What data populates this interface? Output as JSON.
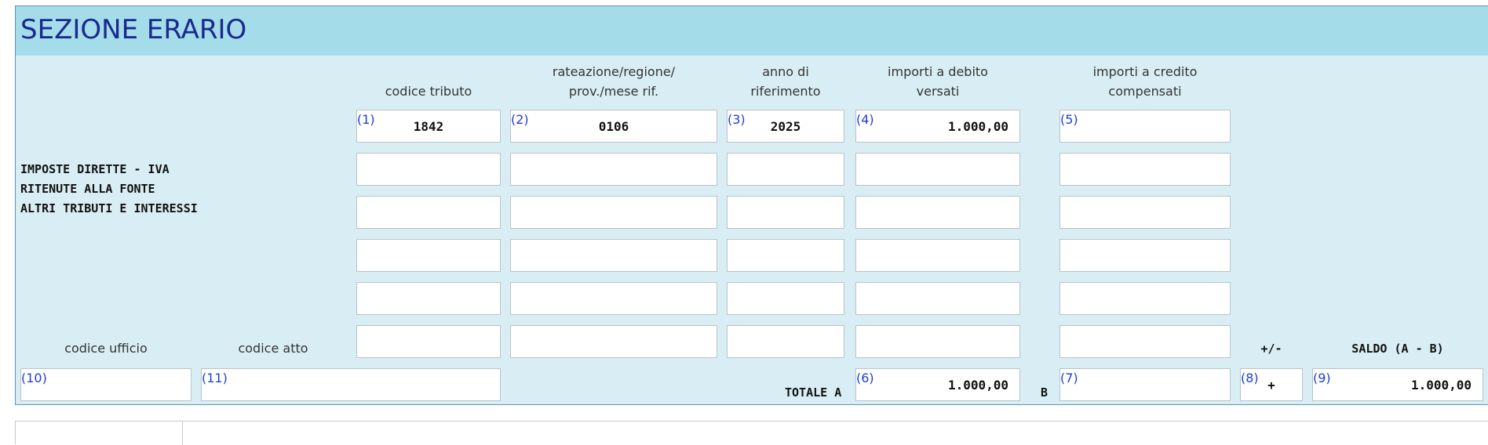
{
  "section": {
    "title": "SEZIONE ERARIO"
  },
  "columns": {
    "codice_tributo": "codice tributo",
    "rateazione": "rateazione/regione/\nprov./mese rif.",
    "anno": "anno di\nriferimento",
    "debito": "importi a debito\nversati",
    "credito": "importi a credito\ncompensati"
  },
  "indices": {
    "i1": "(1)",
    "i2": "(2)",
    "i3": "(3)",
    "i4": "(4)",
    "i5": "(5)",
    "i6": "(6)",
    "i7": "(7)",
    "i8": "(8)",
    "i9": "(9)",
    "i10": "(10)",
    "i11": "(11)"
  },
  "row1": {
    "codice_tributo": "1842",
    "rateazione": "0106",
    "anno": "2025",
    "debito": "1.000,00",
    "credito": ""
  },
  "tax_labels": {
    "line1": "IMPOSTE DIRETTE - IVA",
    "line2": "RITENUTE ALLA FONTE",
    "line3": "ALTRI TRIBUTI E INTERESSI"
  },
  "footer": {
    "codice_ufficio_label": "codice ufficio",
    "codice_atto_label": "codice atto",
    "sign_label": "+/-",
    "saldo_label": "SALDO (A - B)",
    "totale_a_label": "TOTALE A",
    "b_label": "B",
    "totale_a": "1.000,00",
    "totale_b": "",
    "sign": "+",
    "saldo": "1.000,00",
    "codice_ufficio": "",
    "codice_atto": ""
  }
}
